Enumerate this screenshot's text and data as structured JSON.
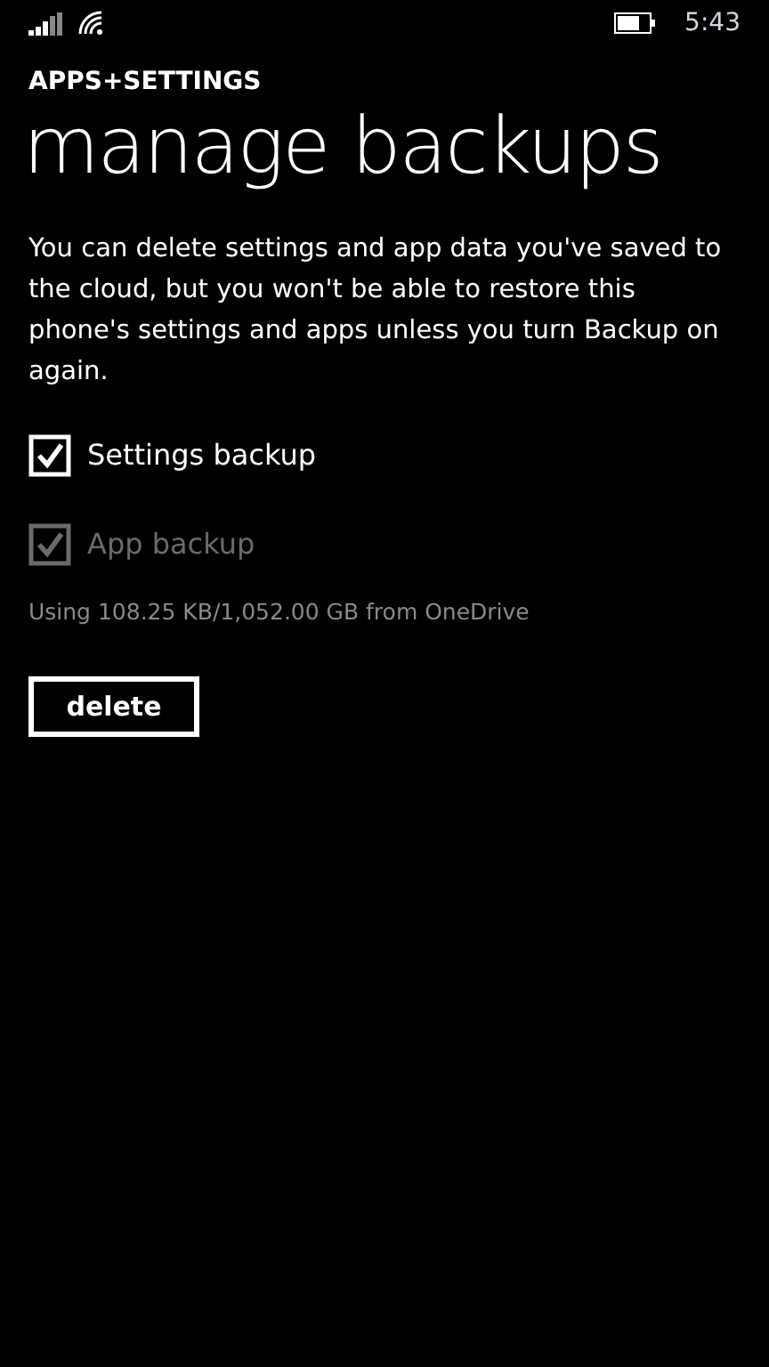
{
  "status_bar": {
    "time": "5:43"
  },
  "header": {
    "app": "APPS+SETTINGS",
    "title": "manage backups"
  },
  "description": "You can delete settings and app data you've saved to the cloud, but you won't be able to restore this phone's settings and apps unless you turn Backup on again.",
  "options": [
    {
      "label": "Settings backup",
      "checked": true,
      "disabled": false
    },
    {
      "label": "App backup",
      "checked": true,
      "disabled": true
    }
  ],
  "usage": "Using 108.25 KB/1,052.00 GB from OneDrive",
  "button": "delete"
}
